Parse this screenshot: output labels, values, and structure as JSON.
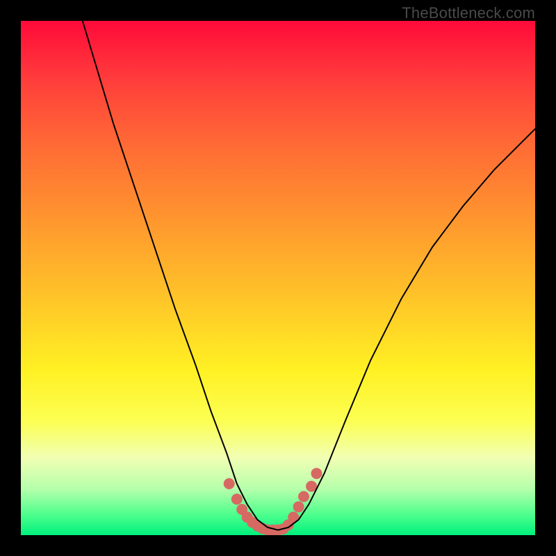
{
  "watermark": "TheBottleneck.com",
  "chart_data": {
    "type": "line",
    "title": "",
    "xlabel": "",
    "ylabel": "",
    "xlim": [
      0,
      100
    ],
    "ylim": [
      0,
      100
    ],
    "grid": false,
    "series": [
      {
        "name": "bottleneck-curve",
        "x": [
          12,
          15,
          18,
          22,
          26,
          30,
          34,
          37,
          40,
          42,
          44,
          46,
          48,
          50,
          52,
          54,
          56,
          59,
          63,
          68,
          74,
          80,
          86,
          92,
          98,
          100
        ],
        "y": [
          100,
          90,
          80,
          68,
          56,
          44,
          33,
          24,
          16,
          10,
          6,
          3,
          1.5,
          1,
          1.5,
          3,
          6,
          12,
          22,
          34,
          46,
          56,
          64,
          71,
          77,
          79
        ],
        "stroke": "#000000",
        "stroke_width": 2
      }
    ],
    "markers": [
      {
        "name": "highlight-dots",
        "x": [
          40.5,
          42,
          43,
          44,
          45,
          46,
          47,
          48,
          49,
          50,
          51,
          52,
          53,
          54,
          55,
          56.5,
          57.5
        ],
        "y": [
          10,
          7,
          5,
          3.5,
          2.5,
          1.8,
          1.3,
          1,
          1,
          1,
          1.2,
          2,
          3.5,
          5.5,
          7.5,
          9.5,
          12
        ],
        "color": "#d66a63",
        "radius": 8
      }
    ]
  },
  "colors": {
    "gradient_top": "#ff0a3a",
    "gradient_bottom": "#00f07c",
    "curve": "#000000",
    "marker": "#d66a63",
    "frame": "#000000"
  }
}
